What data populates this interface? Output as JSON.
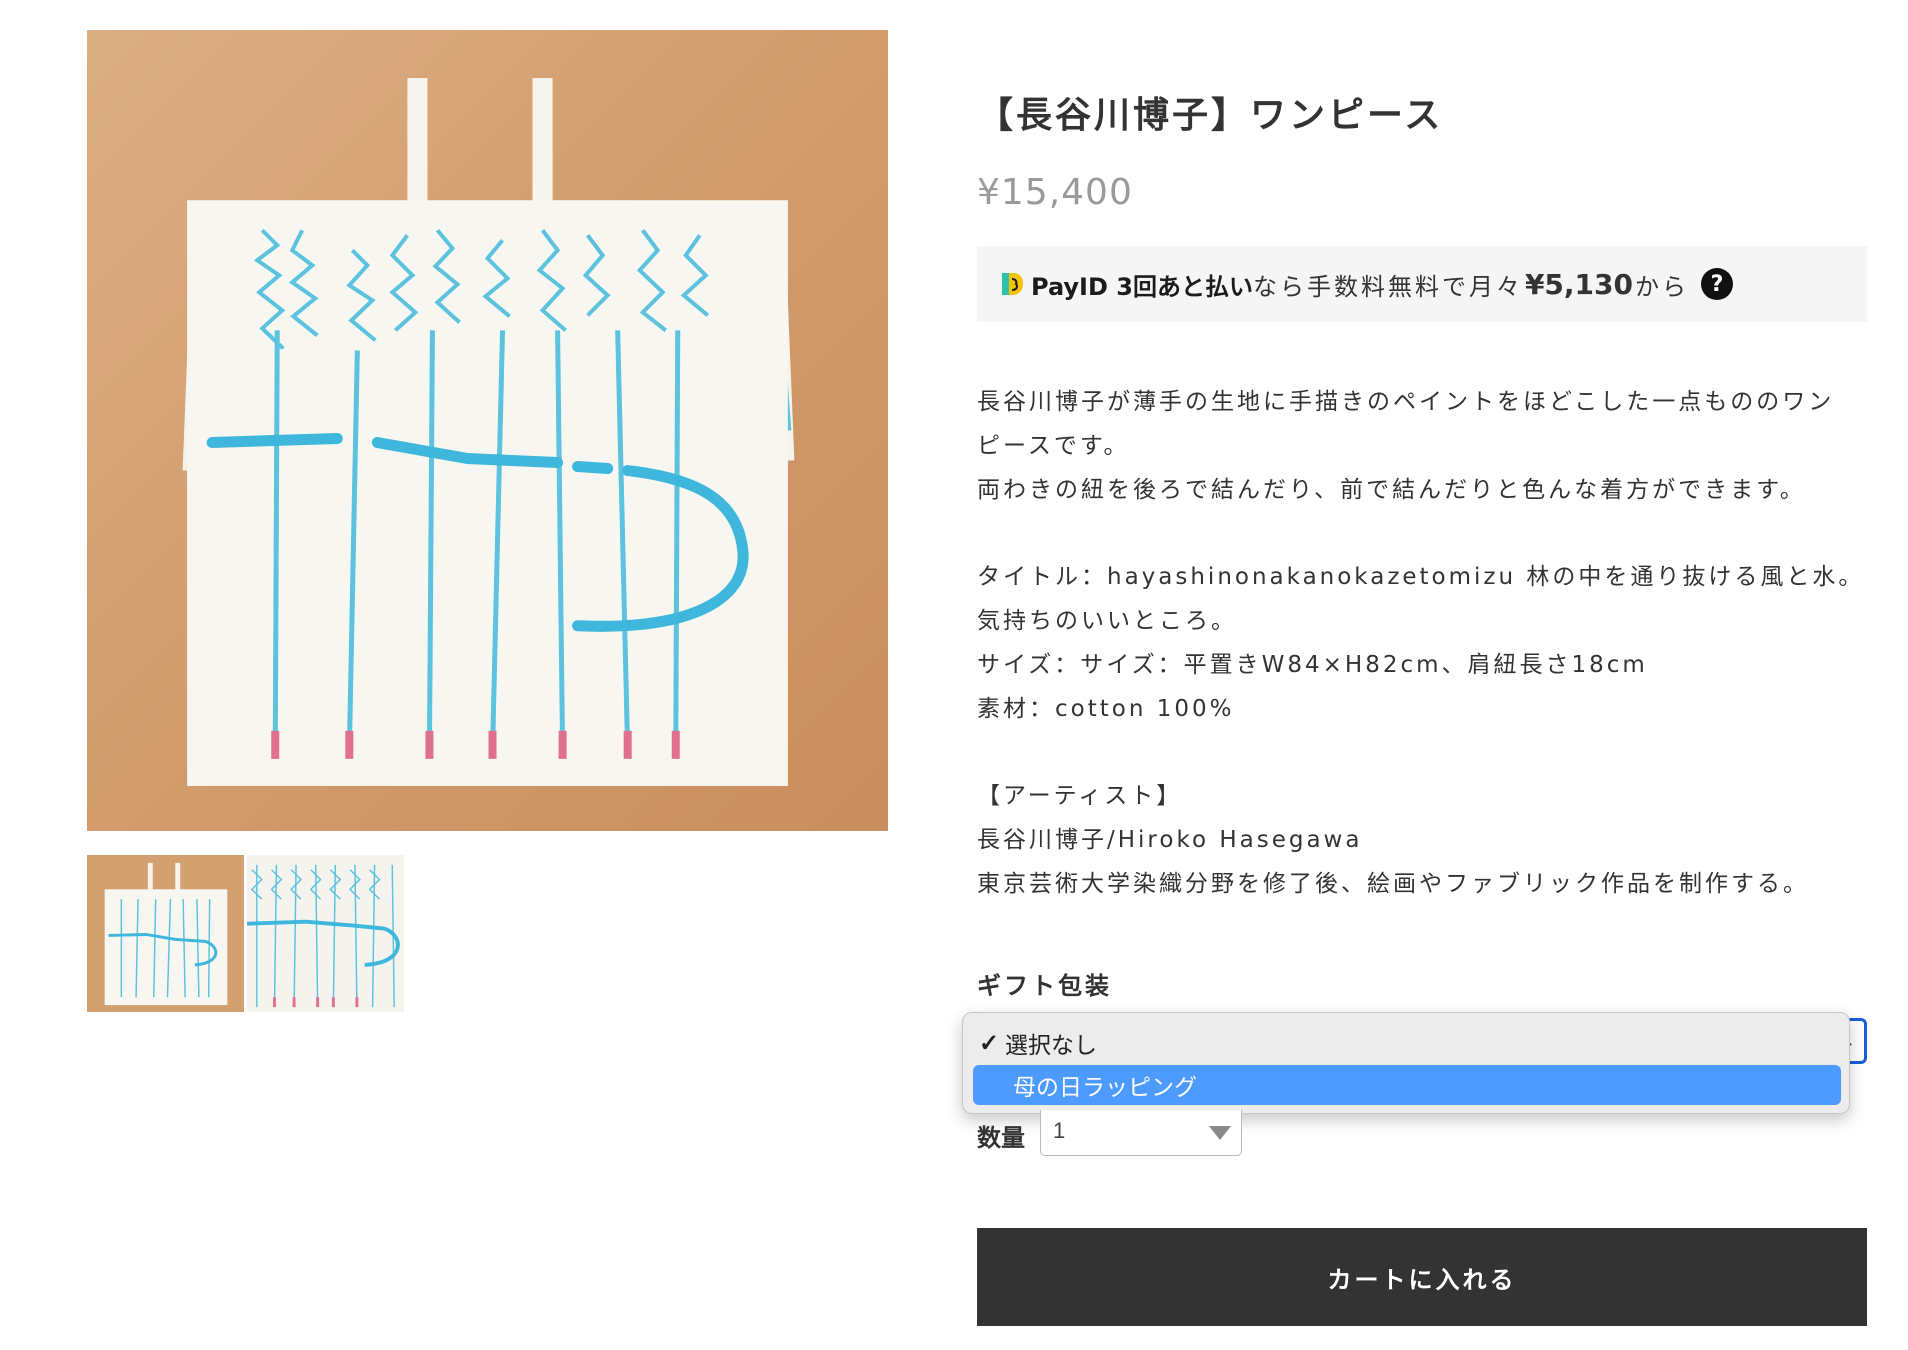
{
  "product": {
    "title": "【長谷川博子】ワンピース",
    "price": "¥15,400"
  },
  "payid": {
    "brand": "PayID 3回あと払い",
    "text_before": "なら手数料無料で月々",
    "amount": "¥5,130",
    "text_after": "から",
    "help_icon": "?",
    "logo_color": "#f5c400",
    "logo_accent": "#2fc0a8"
  },
  "description": {
    "lines_1": [
      "長谷川博子が薄手の生地に手描きのペイントをほどこした一点もののワン",
      "ピースです。",
      "両わきの紐を後ろで結んだり、前で結んだりと色んな着方ができます。"
    ],
    "lines_2": [
      "タイトル：hayashinonakanokazetomizu 林の中を通り抜ける風と水。",
      "気持ちのいいところ。",
      "サイズ：サイズ：平置きW84×H82cm、肩紐長さ18cm",
      "素材：cotton 100%"
    ],
    "lines_3": [
      "【アーティスト】",
      "長谷川博子/Hiroko Hasegawa",
      "東京芸術大学染織分野を修了後、絵画やファブリック作品を制作する。"
    ]
  },
  "gift": {
    "label": "ギフト包装",
    "options": [
      {
        "label": "選択なし",
        "checked": true,
        "highlighted": false
      },
      {
        "label": "母の日ラッピング",
        "checked": false,
        "highlighted": true
      }
    ],
    "checkmark": "✓",
    "highlight_color": "#4d9bff",
    "focus_color": "#1560d6"
  },
  "quantity": {
    "label": "数量",
    "value": "1"
  },
  "cart": {
    "button_label": "カートに入れる",
    "button_color": "#333333"
  },
  "images": {
    "main": "product-photo",
    "thumbnails": [
      "thumbnail-1",
      "thumbnail-2"
    ],
    "background_color": "#d8a478",
    "paint_color": "#5cc2de",
    "tip_color": "#e0708e"
  }
}
